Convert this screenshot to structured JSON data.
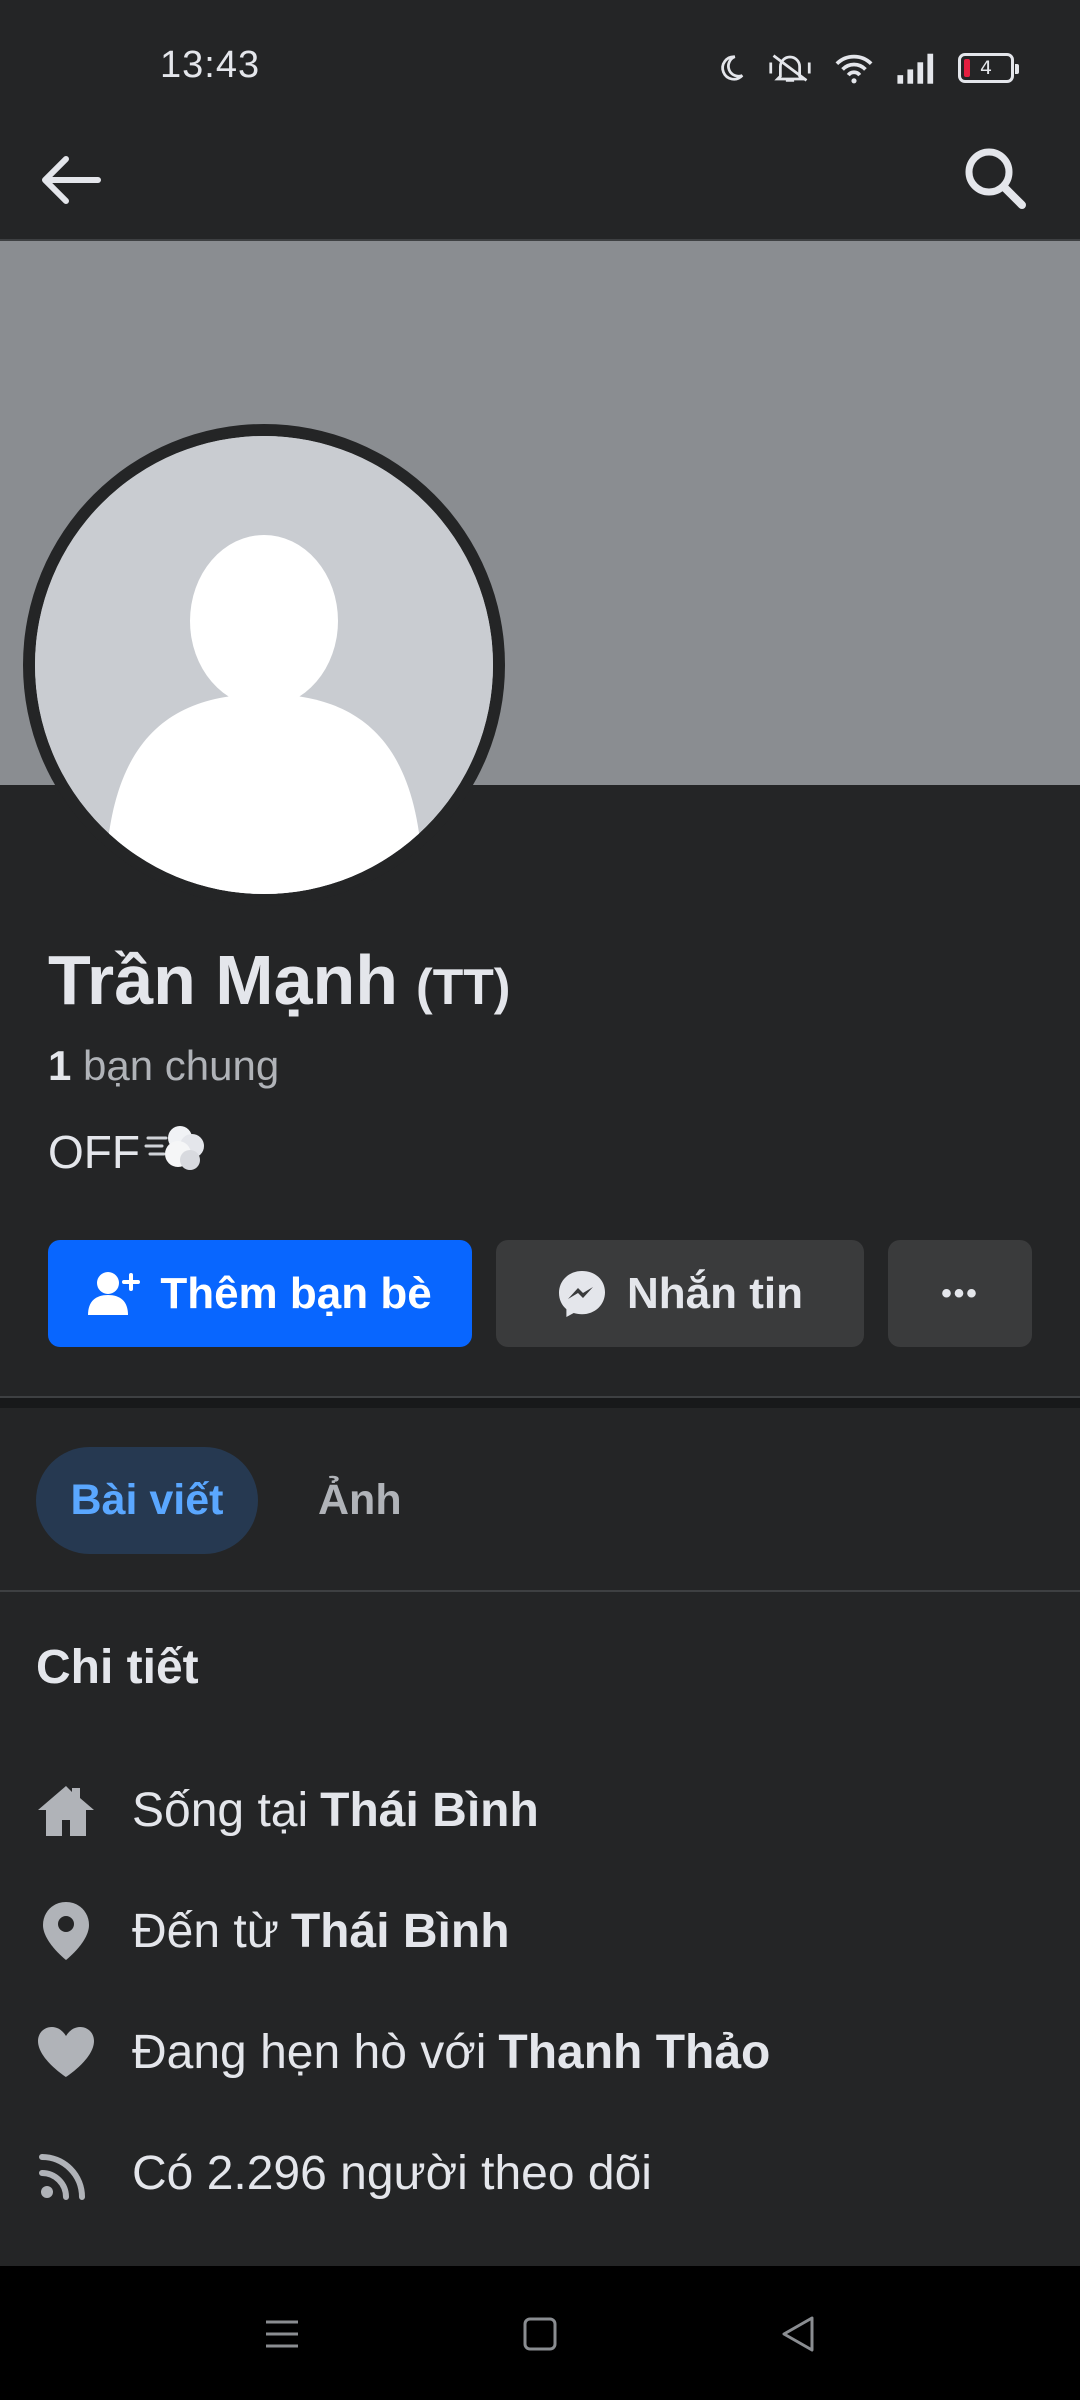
{
  "status_bar": {
    "time": "13:43",
    "battery_level": "4",
    "icons": [
      "moon-icon",
      "mute-icon",
      "wifi-icon",
      "signal-icon",
      "battery-icon"
    ]
  },
  "nav": {
    "back_icon": "arrow-left-icon",
    "search_icon": "search-icon"
  },
  "profile": {
    "name": "Trần Mạnh",
    "name_suffix": "(TT)",
    "mutual_count": "1",
    "mutual_label": "bạn chung",
    "bio": "OFF"
  },
  "actions": {
    "add_friend": "Thêm bạn bè",
    "message": "Nhắn tin",
    "more": "•••"
  },
  "tabs": [
    {
      "label": "Bài viết",
      "active": true
    },
    {
      "label": "Ảnh",
      "active": false
    }
  ],
  "details": {
    "title": "Chi tiết",
    "items": [
      {
        "icon": "home-icon",
        "prefix": "Sống tại",
        "value": "Thái Bình"
      },
      {
        "icon": "location-pin-icon",
        "prefix": "Đến từ",
        "value": "Thái Bình"
      },
      {
        "icon": "heart-icon",
        "prefix": "Đang hẹn hò với",
        "value": "Thanh Thảo"
      },
      {
        "icon": "rss-icon",
        "prefix": "Có 2.296 người theo dõi",
        "value": ""
      }
    ]
  },
  "colors": {
    "background": "#242526",
    "primary_button": "#0866ff",
    "secondary_button": "#3a3b3c",
    "active_tab_bg": "#263951",
    "active_tab_text": "#5aa7ff",
    "cover": "#8a8d91"
  }
}
